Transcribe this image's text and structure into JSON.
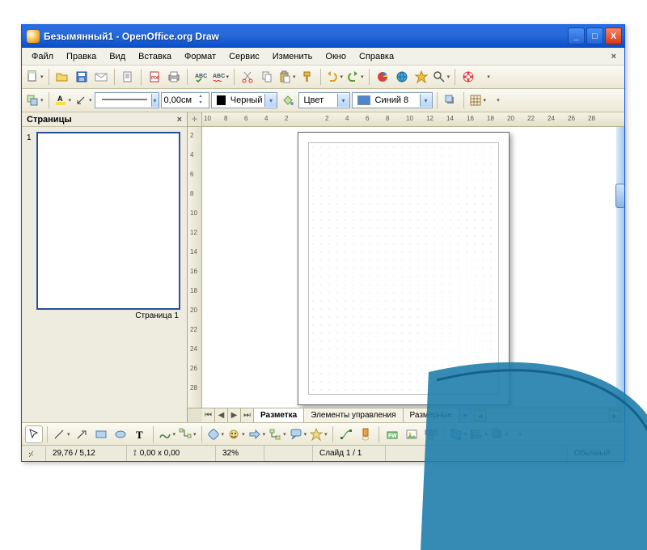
{
  "window": {
    "title": "Безымянный1 - OpenOffice.org Draw"
  },
  "menu": {
    "file": "Файл",
    "edit": "Правка",
    "view": "Вид",
    "insert": "Вставка",
    "format": "Формат",
    "tools": "Сервис",
    "modify": "Изменить",
    "window": "Окно",
    "help": "Справка"
  },
  "formatbar": {
    "line_width": "0,00см",
    "line_color_label": "Черный",
    "fill_label": "Цвет",
    "color_name": "Синий 8"
  },
  "pages_panel": {
    "title": "Страницы",
    "thumb_num": "1",
    "thumb_label": "Страница 1"
  },
  "ruler_h": [
    "10",
    "8",
    "6",
    "4",
    "2",
    "",
    "2",
    "4",
    "6",
    "8",
    "10",
    "12",
    "14",
    "16",
    "18",
    "20",
    "22",
    "24",
    "26",
    "28"
  ],
  "ruler_v": [
    "2",
    "4",
    "6",
    "8",
    "10",
    "12",
    "14",
    "16",
    "18",
    "20",
    "22",
    "24",
    "26",
    "28"
  ],
  "tabs": {
    "t1": "Разметка",
    "t2": "Элементы управления",
    "t3": "Размерные"
  },
  "status": {
    "coords": "29,76 / 5,12",
    "size": "0,00 x 0,00",
    "zoom": "32%",
    "slide": "Слайд 1 / 1",
    "mode": "Обычный"
  }
}
